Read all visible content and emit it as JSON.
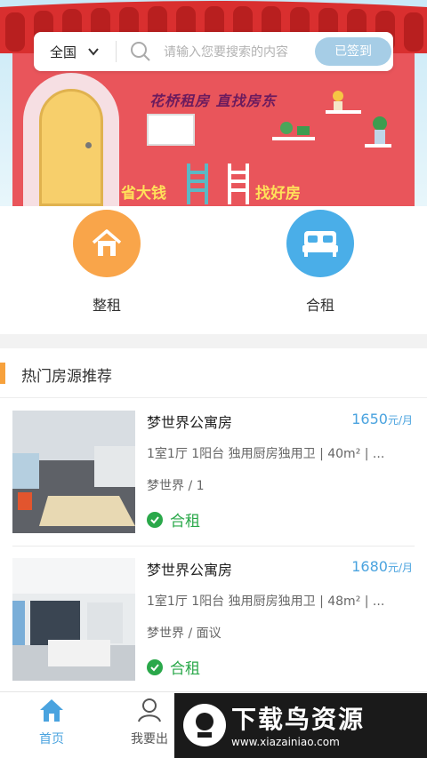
{
  "banner": {
    "slogan_top": "花桥租房  直找房东",
    "slogan_left": "省大钱",
    "slogan_right": "找好房"
  },
  "search": {
    "city": "全国",
    "placeholder": "请输入您要搜索的内容",
    "checkin_label": "已签到"
  },
  "categories": [
    {
      "label": "整租",
      "icon": "home-icon",
      "color": "#f9a54a"
    },
    {
      "label": "合租",
      "icon": "bed-icon",
      "color": "#4aaee8"
    }
  ],
  "hot": {
    "title": "热门房源推荐"
  },
  "listings": [
    {
      "title": "梦世界公寓房",
      "price": "1650",
      "unit": "元/月",
      "desc": "1室1厅 1阳台 独用厨房独用卫 | 40m² | ...",
      "location": "梦世界 / 1",
      "tag": "合租"
    },
    {
      "title": "梦世界公寓房",
      "price": "1680",
      "unit": "元/月",
      "desc": "1室1厅 1阳台 独用厨房独用卫 | 48m² | ...",
      "location": "梦世界 / 面议",
      "tag": "合租"
    }
  ],
  "tabbar": {
    "items": [
      {
        "label": "首页",
        "icon": "home-icon",
        "active": true
      },
      {
        "label": "我要出",
        "icon": "user-icon",
        "active": false
      }
    ]
  },
  "watermark": {
    "text": "下载鸟资源",
    "url": "www.xiazainiao.com"
  },
  "colors": {
    "accent": "#4aa3df",
    "orange": "#f9a54a",
    "green": "#2aa84a",
    "banner_red": "#e9555b"
  }
}
